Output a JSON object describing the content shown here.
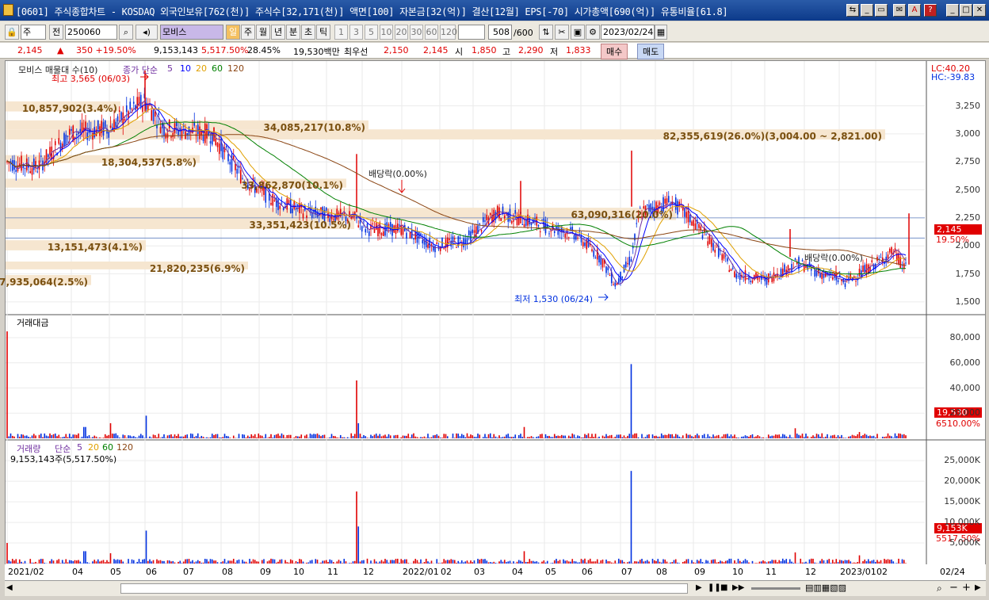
{
  "window": {
    "title": "[0601] 주식종합차트 - KOSDAQ 외국인보유[762(천)] 주식수[32,171(천)] 액면[100] 자본금[32(억)] 결산[12월] EPS[-70] 시가총액[690(억)] 유통비율[61.8]"
  },
  "toolbar": {
    "period": "주",
    "jeon": "전",
    "code": "250060",
    "name": "모비스",
    "day": "일",
    "week": "주",
    "month": "월",
    "year": "년",
    "minute": "분",
    "second": "초",
    "tick": "틱",
    "periods": [
      "1",
      "3",
      "5",
      "10",
      "20",
      "30",
      "60",
      "120"
    ],
    "count": "508",
    "total": "/600",
    "date": "2023/02/24"
  },
  "quote": {
    "price": "2,145",
    "change": "350 +19.50%",
    "volume": "9,153,143",
    "vol_ratio": "5,517.50%",
    "turnover": "28.45%",
    "amount": "19,530백만",
    "best_label": "최우선",
    "ask": "2,150",
    "bid": "2,145",
    "open_label": "시",
    "open": "1,850",
    "high_label": "고",
    "high": "2,290",
    "low_label": "저",
    "low": "1,833",
    "buy": "매수",
    "sell": "매도"
  },
  "price_panel": {
    "legend_name": "모비스 매물대 수(10)",
    "legend_ma": "종가 단순",
    "ma_periods": [
      "5",
      "10",
      "20",
      "60",
      "120"
    ],
    "ma_colors": [
      "#7030a0",
      "#0000ff",
      "#e0a000",
      "#008000",
      "#8b4513"
    ],
    "lc": "LC:40.20",
    "hc": "HC:-39.83",
    "high_note": "최고 3,565 (06/03)",
    "low_note": "최저 1,530 (06/24)",
    "div1": "배당락(0.00%)",
    "div2": "배당락(0.00%)",
    "y_ticks": [
      "3,250",
      "3,000",
      "2,750",
      "2,500",
      "2,250",
      "2,000",
      "1,750",
      "1,500"
    ],
    "last_price": "2,145",
    "last_pct": "19.50%",
    "volume_profile": [
      {
        "label": "10,857,902(3.4%)"
      },
      {
        "label": "34,085,217(10.8%)"
      },
      {
        "label": "82,355,619(26.0%)(3,004.00 ~ 2,821.00)"
      },
      {
        "label": "18,304,537(5.8%)"
      },
      {
        "label": "33,862,870(10.1%)"
      },
      {
        "label": "63,090,316(20.0%)"
      },
      {
        "label": "33,351,423(10.5%)"
      },
      {
        "label": "13,151,473(4.1%)"
      },
      {
        "label": "21,820,235(6.9%)"
      },
      {
        "label": "7,935,064(2.5%)"
      }
    ]
  },
  "amount_panel": {
    "title": "거래대금",
    "y_ticks": [
      "80,000",
      "60,000",
      "40,000",
      "20,000"
    ],
    "last": "19,530",
    "last_pct": "6510.00%"
  },
  "volume_panel": {
    "title": "거래량",
    "legend_ma": "단순",
    "ma_periods": [
      "5",
      "20",
      "60",
      "120"
    ],
    "value_note": "9,153,143주(5,517.50%)",
    "y_ticks": [
      "25,000K",
      "20,000K",
      "15,000K",
      "10,000K",
      "5,000K"
    ],
    "last": "9,153K",
    "last_pct": "5517.50%"
  },
  "xaxis": {
    "labels": [
      "2021/02",
      "04",
      "05",
      "06",
      "07",
      "08",
      "09",
      "10",
      "11",
      "12",
      "2022/01",
      "02",
      "03",
      "04",
      "05",
      "06",
      "07",
      "08",
      "09",
      "10",
      "11",
      "12",
      "2023/01",
      "02"
    ],
    "right": "02/24"
  },
  "colors": {
    "up": "#e00000",
    "down": "#0030e0",
    "band": "#f6e6d0",
    "band_text": "#7a5010"
  }
}
